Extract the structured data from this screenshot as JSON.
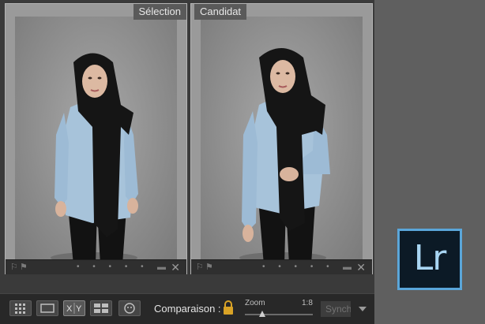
{
  "panels": {
    "left": {
      "tag": "Sélection"
    },
    "right": {
      "tag": "Candidat"
    }
  },
  "panel_bar": {
    "flag_icons": [
      "flag-outline-icon",
      "flag-icon"
    ],
    "dots": "• • • • •",
    "close_glyph": "✕"
  },
  "toolbar": {
    "view_buttons": [
      "grid-view-icon",
      "loupe-view-icon",
      "compare-view-icon",
      "survey-view-icon",
      "people-view-icon"
    ],
    "compare_label": "Comparaison :",
    "lock_icon": "lock-icon",
    "zoom_label": "Zoom",
    "zoom_value": "1:8",
    "zoom_level": 0.25,
    "sync_label": "Synch",
    "dropdown_icon": "chevron-down-icon"
  },
  "logo": {
    "text": "Lr"
  },
  "colors": {
    "logo_border": "#5aa6da",
    "logo_bg": "#0c1a26",
    "logo_text": "#a9d6f3",
    "lock": "#d9a326"
  }
}
